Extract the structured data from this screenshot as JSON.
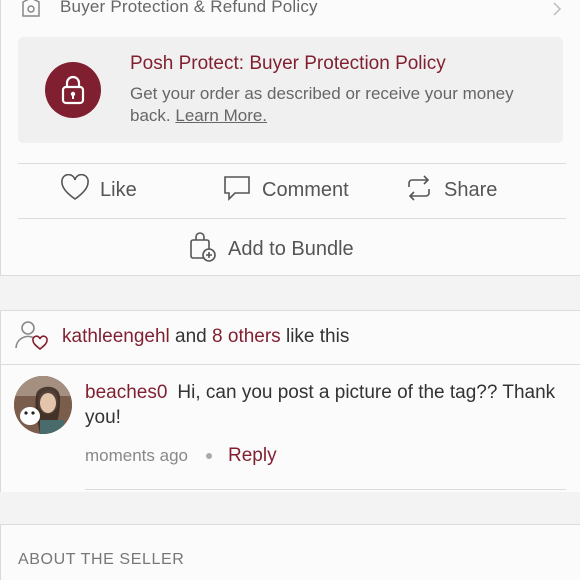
{
  "policy_row": {
    "label": "Buyer Protection & Refund Policy"
  },
  "posh_protect": {
    "title": "Posh Protect: Buyer Protection Policy",
    "description": "Get your order as described or receive your money back.",
    "link": "Learn More."
  },
  "actions": {
    "like": "Like",
    "comment": "Comment",
    "share": "Share",
    "bundle": "Add to Bundle"
  },
  "likes": {
    "user": "kathleengehl",
    "and": "and",
    "others": "8 others",
    "suffix": "like this"
  },
  "comment": {
    "user": "beaches0",
    "text": "Hi, can you post a picture of the tag?? Thank you!",
    "time": "moments ago",
    "reply": "Reply"
  },
  "about_section": {
    "title": "ABOUT THE SELLER"
  },
  "colors": {
    "accent": "#7f1f2f",
    "text_muted": "#666666",
    "card_bg": "#f1f0f0"
  },
  "icons": [
    "shield-icon",
    "chevron-right-icon",
    "lock-icon",
    "heart-icon",
    "comment-icon",
    "share-icon",
    "bundle-icon",
    "user-heart-icon"
  ]
}
